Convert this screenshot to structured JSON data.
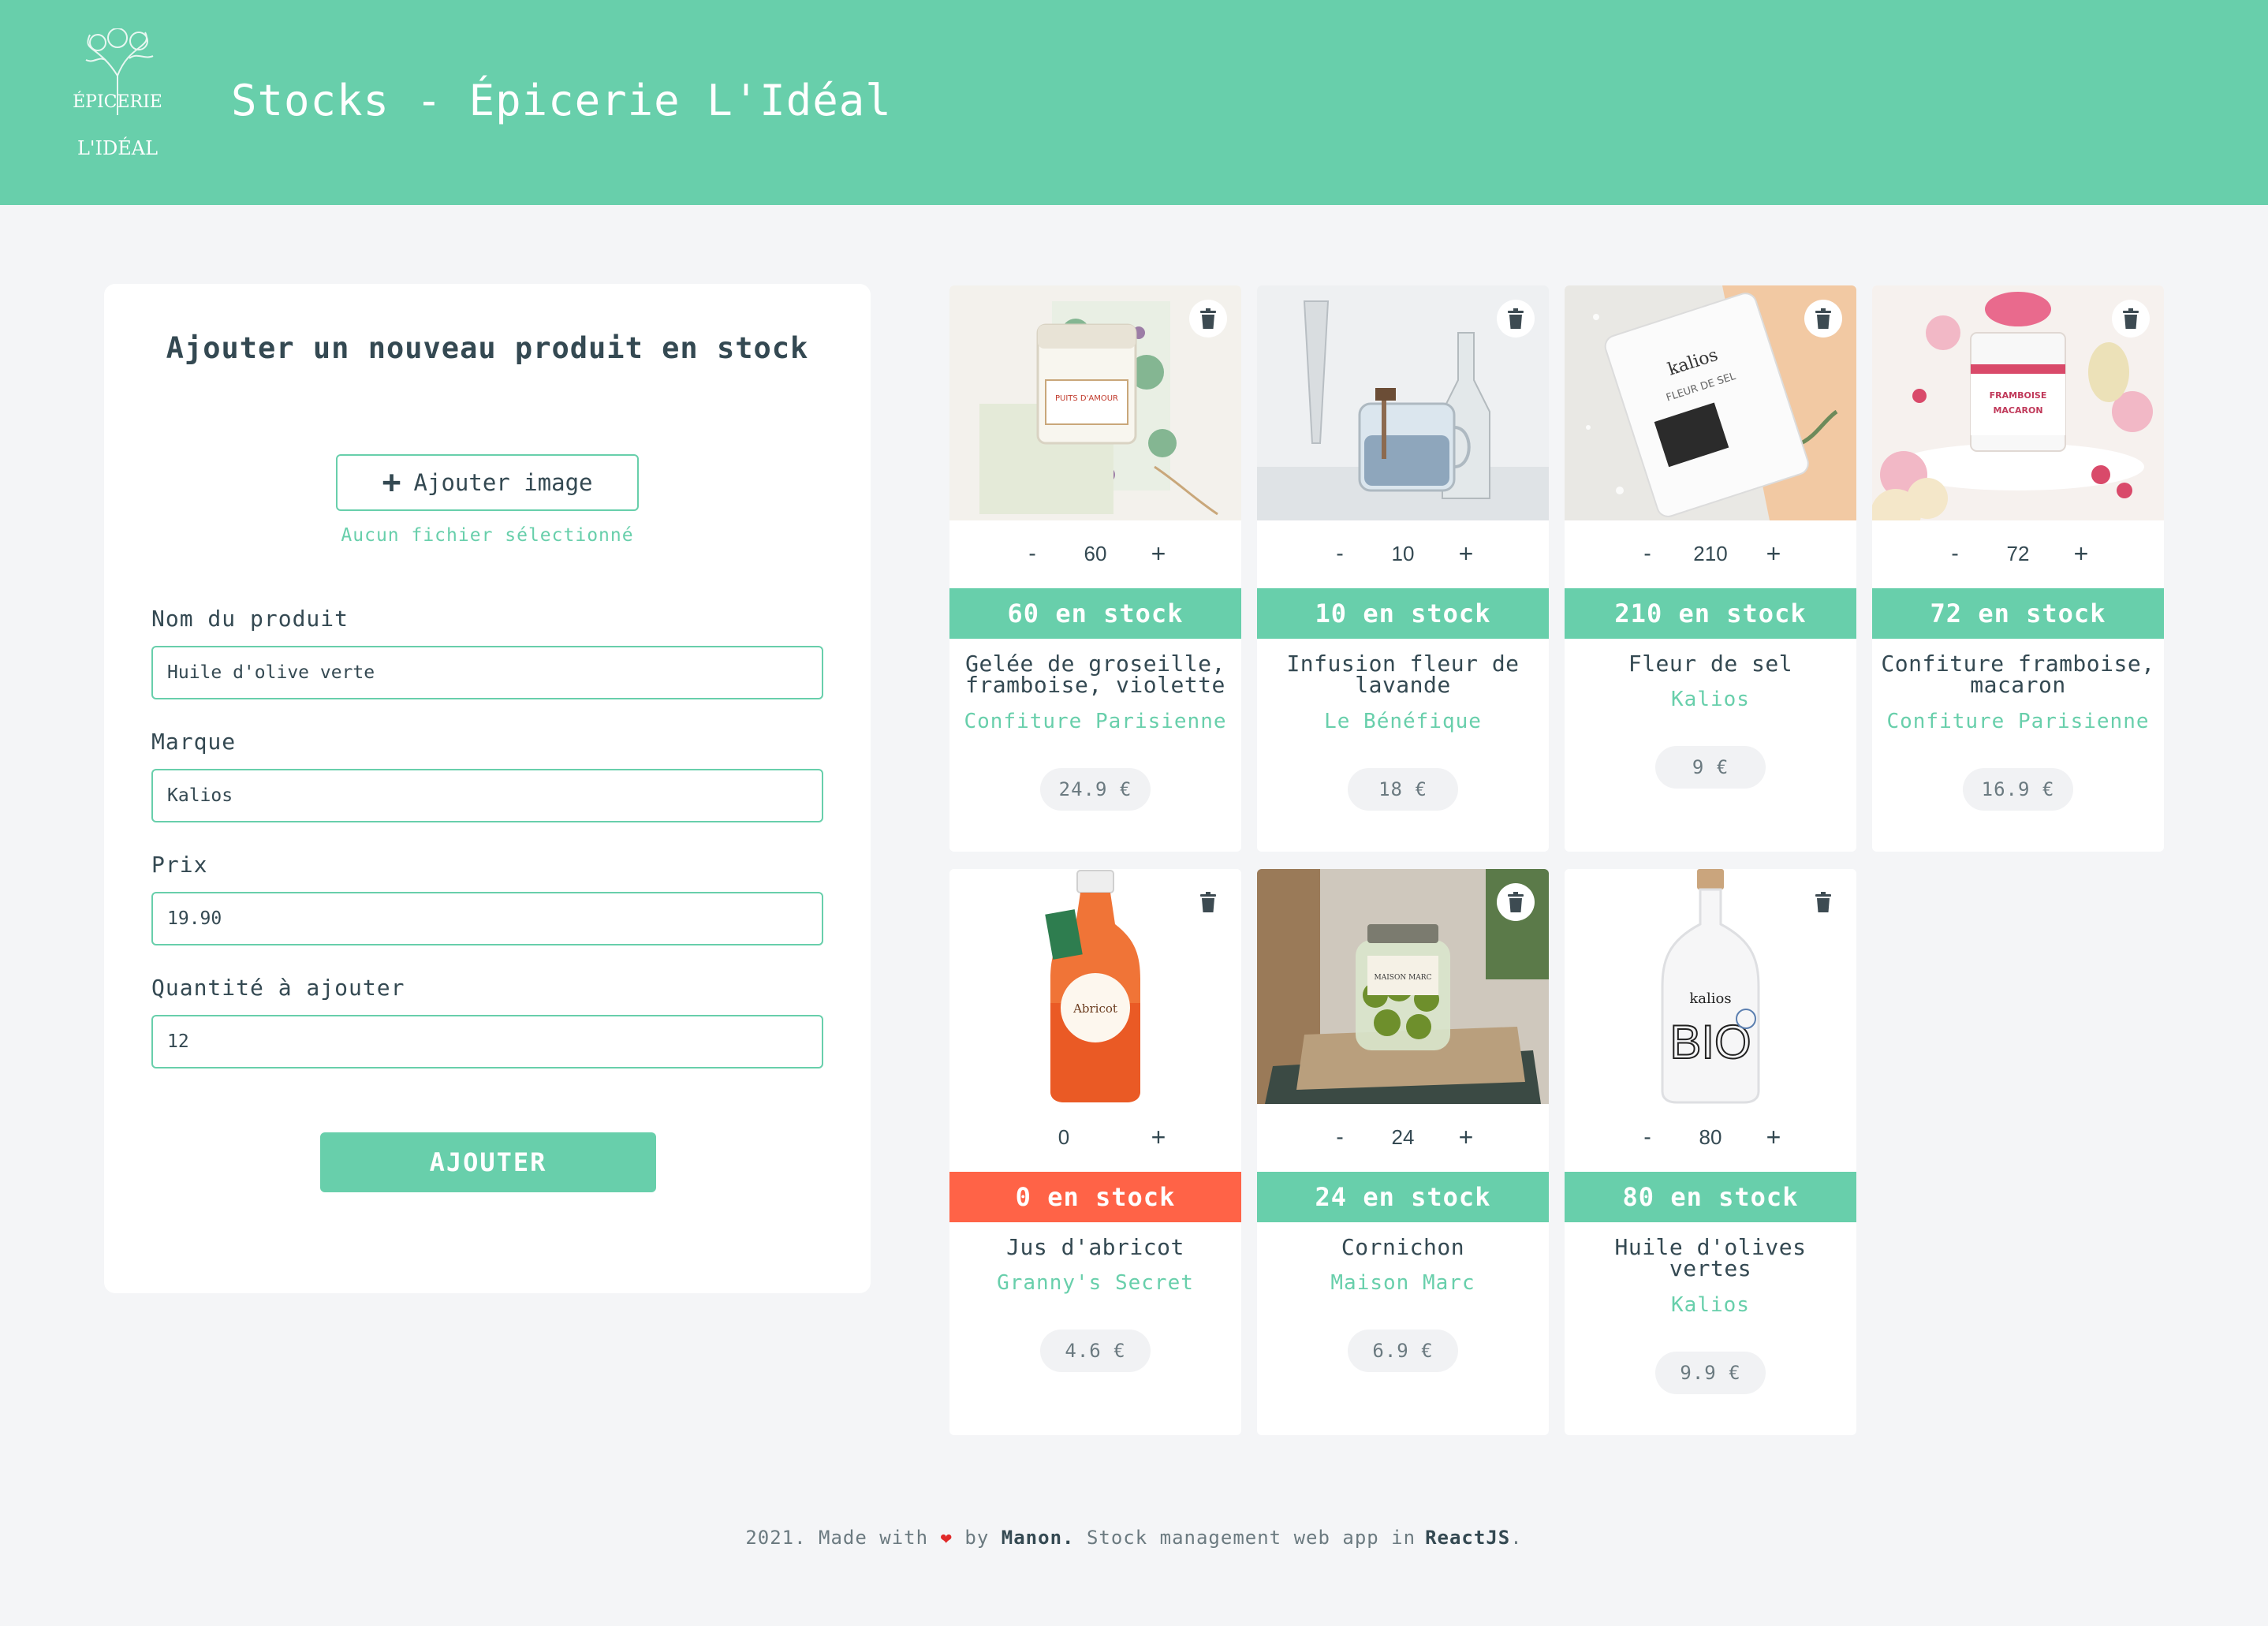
{
  "header": {
    "title": "Stocks - Épicerie L'Idéal",
    "logo_text_top": "ÉPICERIE",
    "logo_text_bottom": "L'IDÉAL"
  },
  "form": {
    "title": "Ajouter un nouveau produit en stock",
    "add_image_label": "Ajouter image",
    "no_file_text": "Aucun fichier sélectionné",
    "fields": [
      {
        "label": "Nom du produit",
        "value": "Huile d'olive verte"
      },
      {
        "label": "Marque",
        "value": "Kalios"
      },
      {
        "label": "Prix",
        "value": "19.90"
      },
      {
        "label": "Quantité à ajouter",
        "value": "12"
      }
    ],
    "submit_label": "AJOUTER"
  },
  "products": [
    {
      "qty": "60",
      "stock": "60 en stock",
      "name": "Gelée de groseille, framboise, violette",
      "brand": "Confiture Parisienne",
      "price": "24.9 €",
      "image": "jam-jar-puits-d-amour"
    },
    {
      "qty": "10",
      "stock": "10 en stock",
      "name": "Infusion fleur de lavande",
      "brand": "Le Bénéfique",
      "price": "18 €",
      "image": "glass-tea-infusion"
    },
    {
      "qty": "210",
      "stock": "210 en stock",
      "name": "Fleur de sel",
      "brand": "Kalios",
      "price": "9 €",
      "image": "salt-pouch"
    },
    {
      "qty": "72",
      "stock": "72 en stock",
      "name": "Confiture framboise, macaron",
      "brand": "Confiture Parisienne",
      "price": "16.9 €",
      "image": "macaron-jam-jar"
    },
    {
      "qty": "0",
      "stock": "0 en stock",
      "name": "Jus d'abricot",
      "brand": "Granny's Secret",
      "price": "4.6 €",
      "image": "apricot-juice-bottle"
    },
    {
      "qty": "24",
      "stock": "24 en stock",
      "name": "Cornichon",
      "brand": "Maison Marc",
      "price": "6.9 €",
      "image": "pickle-jar"
    },
    {
      "qty": "80",
      "stock": "80 en stock",
      "name": "Huile d'olives vertes",
      "brand": "Kalios",
      "price": "9.9 €",
      "image": "olive-oil-bottle"
    }
  ],
  "product_labels": {
    "jam_label": "PUITS D'AMOUR",
    "macaron_label_1": "FRAMBOISE",
    "macaron_label_2": "MACARON",
    "salt_brand": "kalios",
    "salt_text": "FLEUR DE SEL",
    "apricot_label": "Abricot",
    "pickle_label": "MAISON MARC",
    "oil_brand": "kalios",
    "oil_text": "BIO"
  },
  "footer": {
    "prefix": "2021. Made with",
    "by": "by",
    "author": "Manon.",
    "middle": "Stock management web app in",
    "tech": "ReactJS",
    "suffix": "."
  },
  "colors": {
    "accent": "#68cfab",
    "out_of_stock": "#ff6347",
    "text": "#344952",
    "background": "#f4f5f7"
  }
}
